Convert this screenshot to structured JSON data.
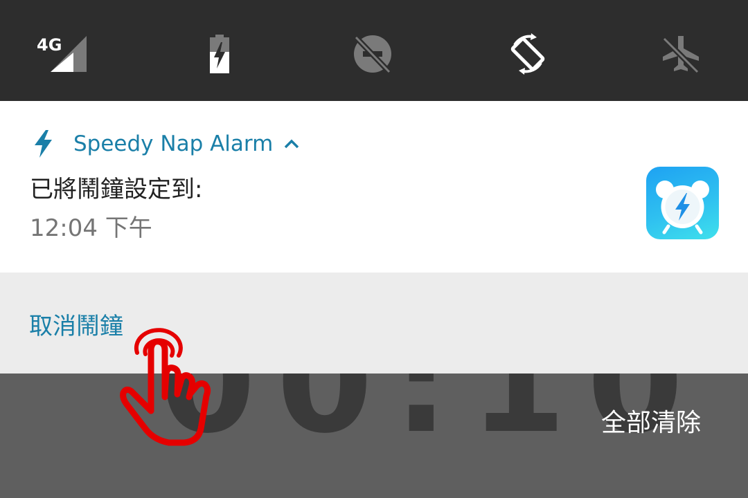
{
  "quick_settings": {
    "network_label": "4G",
    "tiles": [
      {
        "icon": "signal-4g-icon"
      },
      {
        "icon": "battery-charging-icon"
      },
      {
        "icon": "do-not-disturb-off-icon"
      },
      {
        "icon": "auto-rotate-icon"
      },
      {
        "icon": "airplane-mode-off-icon"
      }
    ]
  },
  "notification": {
    "app_icon": "lightning-icon",
    "app_name": "Speedy Nap Alarm",
    "title": "已將鬧鐘設定到:",
    "text": "12:04 下午",
    "large_icon": "alarm-clock-app-icon",
    "accent_color": "#1a7fa8",
    "action_label": "取消鬧鐘"
  },
  "background": {
    "clock_text": "00:10"
  },
  "shade_footer": {
    "clear_all_label": "全部清除"
  },
  "overlay": {
    "icon": "tap-hand-icon",
    "color": "#e50000"
  }
}
